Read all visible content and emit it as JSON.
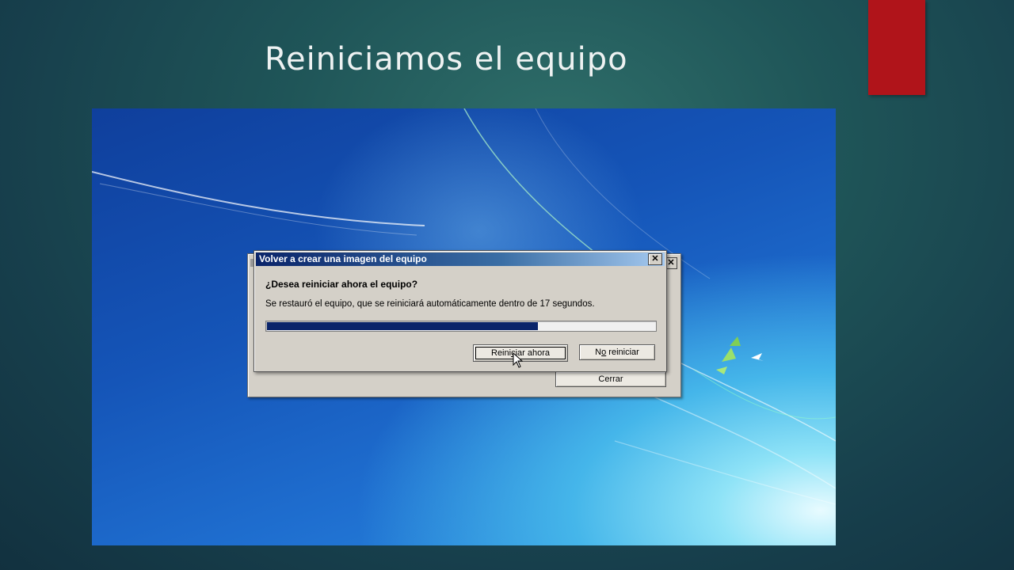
{
  "slide": {
    "title": "Reiniciamos el equipo",
    "accent_color": "#b0141a"
  },
  "back_dialog": {
    "close_glyph": "✕",
    "close_button_label": "Cerrar"
  },
  "dialog": {
    "title": "Volver a crear una imagen del equipo",
    "close_glyph": "✕",
    "question": "¿Desea reiniciar ahora el equipo?",
    "message": "Se restauró el equipo, que se reiniciará automáticamente dentro de 17 segundos.",
    "progress_fraction": 0.7,
    "restart_button": {
      "pre": "Reini",
      "underlined": "c",
      "post": "iar ahora"
    },
    "no_restart_button": {
      "pre": "N",
      "underlined": "o",
      "post": " reiniciar"
    },
    "title_color": "#0a246a",
    "progress_color": "#0a246a"
  },
  "cursor_icon": "arrow-cursor-icon"
}
